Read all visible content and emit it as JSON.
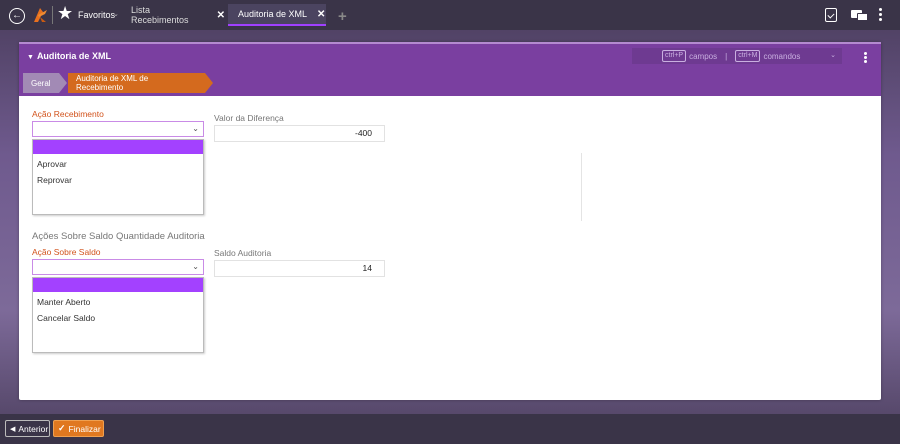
{
  "topbar": {
    "favorites_label": "Favoritos",
    "tabs": [
      {
        "label": "Lista Recebimentos",
        "close": "✕"
      },
      {
        "label": "Auditoria de XML",
        "close": "✕"
      }
    ],
    "add_tab": "+",
    "icons": [
      "back-icon",
      "logo-icon",
      "star-icon",
      "clipboard-check-icon",
      "chat-icon",
      "kebab-icon"
    ]
  },
  "panel": {
    "title": "Auditoria de XML",
    "shortcuts": {
      "fields_key": "ctrl+P",
      "fields_label": "campos",
      "separator": "|",
      "commands_key": "ctrl+M",
      "commands_label": "comandos"
    },
    "breadcrumb": [
      "Geral",
      "Auditoria de XML de Recebimento"
    ]
  },
  "form": {
    "acao_recebimento": {
      "label": "Ação Recebimento",
      "value": "",
      "options": [
        "",
        "Aprovar",
        "Reprovar"
      ]
    },
    "valor_diferenca": {
      "label": "Valor da Diferença",
      "value": "-400"
    },
    "section_title": "Ações Sobre Saldo Quantidade Auditoria",
    "acao_saldo": {
      "label": "Ação Sobre Saldo",
      "value": "",
      "options": [
        "",
        "Manter Aberto",
        "Cancelar Saldo"
      ]
    },
    "saldo_auditoria": {
      "label": "Saldo Auditoria",
      "value": "14"
    }
  },
  "footer": {
    "prev_label": "Anterior",
    "finish_label": "Finalizar"
  },
  "colors": {
    "topbar": "#3a3448",
    "header_purple": "#7a3fa0",
    "accent_orange": "#d46a1e",
    "selected_option": "#a341ff",
    "label_orange": "#d2531c"
  }
}
